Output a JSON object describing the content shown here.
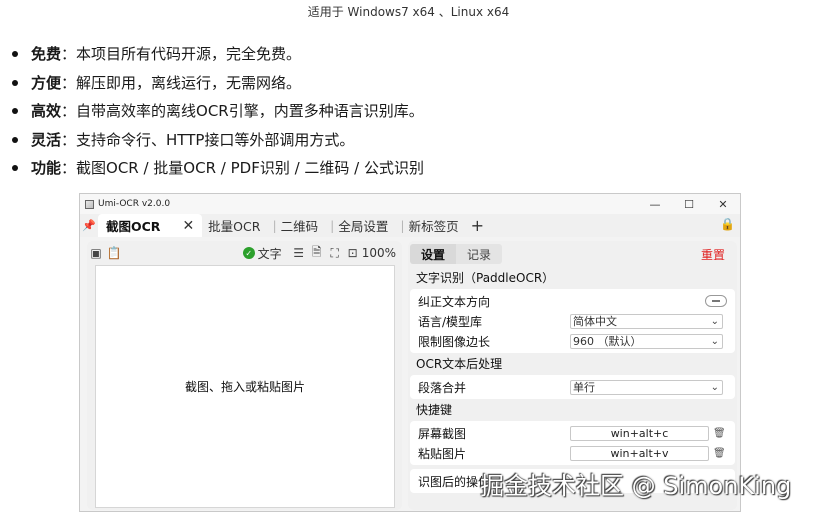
{
  "header": {
    "platform": "适用于 Windows7 x64 、Linux x64"
  },
  "features": [
    {
      "term": "免费",
      "desc": "：本项目所有代码开源，完全免费。"
    },
    {
      "term": "方便",
      "desc": "：解压即用，离线运行，无需网络。"
    },
    {
      "term": "高效",
      "desc": "：自带高效率的离线OCR引擎，内置多种语言识别库。"
    },
    {
      "term": "灵活",
      "desc": "：支持命令行、HTTP接口等外部调用方式。"
    },
    {
      "term": "功能",
      "desc": "：截图OCR / 批量OCR / PDF识别 / 二维码 / 公式识别"
    }
  ],
  "window": {
    "title": "Umi-OCR v2.0.0",
    "controls": {
      "minimize": "—",
      "maximize": "☐",
      "close": "✕"
    },
    "pin_icon": "pin-icon",
    "tabs": [
      {
        "label": "截图OCR",
        "active": true
      },
      {
        "label": "批量OCR"
      },
      {
        "label": "二维码"
      },
      {
        "label": "全局设置"
      },
      {
        "label": "新标签页"
      }
    ],
    "tab_close": "✕",
    "add_tab": "+",
    "lock_icon": "lock-icon"
  },
  "left_panel": {
    "text_toggle": "文字",
    "zoom": "100%",
    "canvas_hint": "截图、拖入或粘贴图片"
  },
  "right_panel": {
    "tabs": [
      "设置",
      "记录"
    ],
    "reset": "重置",
    "sections": {
      "ocr": {
        "title": "文字识别（PaddleOCR）",
        "rows": {
          "orientation": "纠正文本方向",
          "language": {
            "label": "语言/模型库",
            "value": "简体中文"
          },
          "limit": {
            "label": "限制图像边长",
            "value": "960 （默认）"
          }
        }
      },
      "post": {
        "title": "OCR文本后处理",
        "paragraph": {
          "label": "段落合并",
          "value": "单行"
        }
      },
      "hotkeys": {
        "title": "快捷键",
        "screenshot": {
          "label": "屏幕截图",
          "value": "win+alt+c"
        },
        "paste": {
          "label": "粘贴图片",
          "value": "win+alt+v"
        }
      },
      "after": {
        "title": "识图后的操作"
      }
    }
  },
  "watermark": "掘金技术社区 @ SimonKing",
  "colors": {
    "reset": "#e02020",
    "check": "#2ca02c"
  }
}
